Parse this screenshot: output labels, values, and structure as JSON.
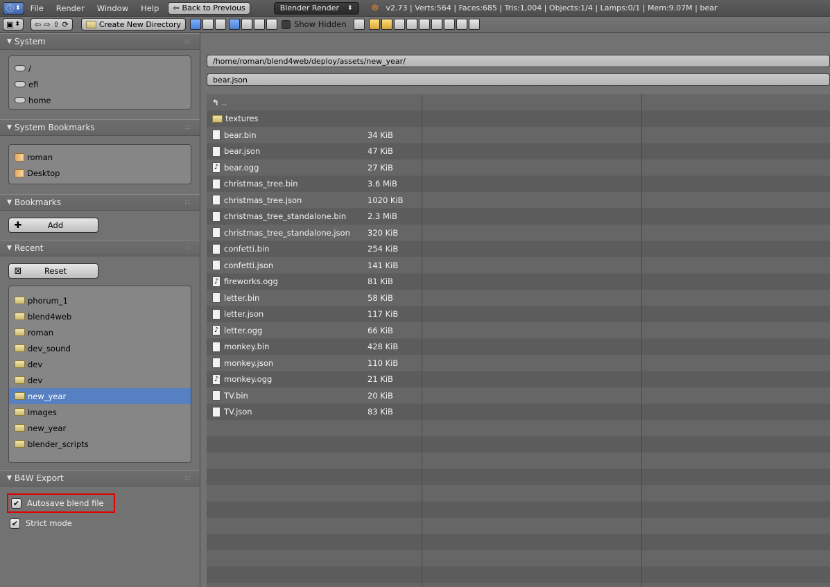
{
  "topbar": {
    "info_button": "ⓘ",
    "menus": [
      "File",
      "Render",
      "Window",
      "Help"
    ],
    "back_button": "Back to Previous",
    "render_engine": "Blender Render",
    "stats": "v2.73 | Verts:564 | Faces:685 | Tris:1,004 | Objects:1/4 | Lamps:0/1 | Mem:9.07M | bear"
  },
  "toolbar": {
    "create_dir": "Create New Directory",
    "show_hidden": "Show Hidden"
  },
  "sidebar": {
    "system": {
      "title": "System",
      "items": [
        "/",
        "efi",
        "home"
      ]
    },
    "system_bookmarks": {
      "title": "System Bookmarks",
      "items": [
        "roman",
        "Desktop"
      ]
    },
    "bookmarks": {
      "title": "Bookmarks",
      "add_label": "Add"
    },
    "recent": {
      "title": "Recent",
      "reset_label": "Reset",
      "items": [
        "phorum_1",
        "blend4web",
        "roman",
        "dev_sound",
        "dev",
        "dev",
        "new_year",
        "images",
        "new_year",
        "blender_scripts"
      ],
      "selected_index": 6
    },
    "b4w_export": {
      "title": "B4W Export",
      "autosave_label": "Autosave blend file",
      "strict_label": "Strict mode"
    }
  },
  "main": {
    "path": "/home/roman/blend4web/deploy/assets/new_year/",
    "filename": "bear.json",
    "parent": "..",
    "files": [
      {
        "name": "textures",
        "size": "",
        "type": "folder"
      },
      {
        "name": "bear.bin",
        "size": "34 KiB",
        "type": "file"
      },
      {
        "name": "bear.json",
        "size": "47 KiB",
        "type": "file"
      },
      {
        "name": "bear.ogg",
        "size": "27 KiB",
        "type": "sound"
      },
      {
        "name": "christmas_tree.bin",
        "size": "3.6 MiB",
        "type": "file"
      },
      {
        "name": "christmas_tree.json",
        "size": "1020 KiB",
        "type": "file"
      },
      {
        "name": "christmas_tree_standalone.bin",
        "size": "2.3 MiB",
        "type": "file"
      },
      {
        "name": "christmas_tree_standalone.json",
        "size": "320 KiB",
        "type": "file"
      },
      {
        "name": "confetti.bin",
        "size": "254 KiB",
        "type": "file"
      },
      {
        "name": "confetti.json",
        "size": "141 KiB",
        "type": "file"
      },
      {
        "name": "fireworks.ogg",
        "size": "81 KiB",
        "type": "sound"
      },
      {
        "name": "letter.bin",
        "size": "58 KiB",
        "type": "file"
      },
      {
        "name": "letter.json",
        "size": "117 KiB",
        "type": "file"
      },
      {
        "name": "letter.ogg",
        "size": "66 KiB",
        "type": "sound"
      },
      {
        "name": "monkey.bin",
        "size": "428 KiB",
        "type": "file"
      },
      {
        "name": "monkey.json",
        "size": "110 KiB",
        "type": "file"
      },
      {
        "name": "monkey.ogg",
        "size": "21 KiB",
        "type": "sound"
      },
      {
        "name": "TV.bin",
        "size": "20 KiB",
        "type": "file"
      },
      {
        "name": "TV.json",
        "size": "83 KiB",
        "type": "file"
      }
    ]
  },
  "colors": {
    "selection": "#5680c2",
    "highlight_box": "#e00000"
  }
}
